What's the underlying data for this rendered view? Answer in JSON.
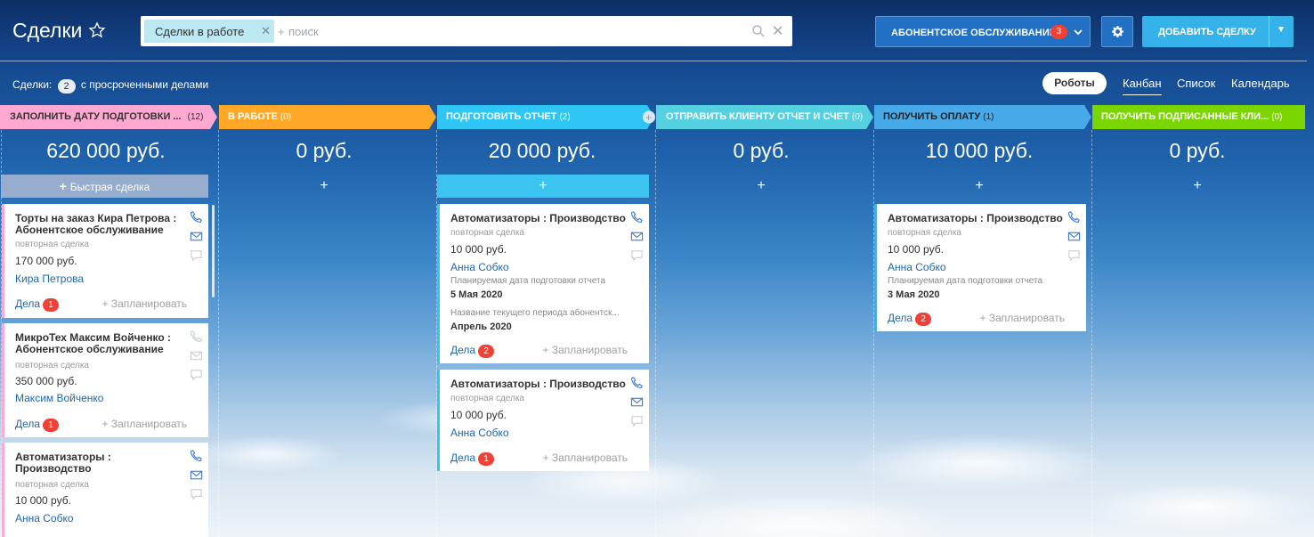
{
  "header": {
    "title": "Сделки",
    "filter_chip": "Сделки в работе",
    "search_plus": "+",
    "search_placeholder": "поиск",
    "category": "АБОНЕНТСКОЕ ОБСЛУЖИВАНИЕ",
    "category_badge": "3",
    "add_deal": "ДОБАВИТЬ СДЕЛКУ"
  },
  "subbar": {
    "deals_label": "Сделки:",
    "deals_count": "2",
    "deals_suffix": "с просроченными делами",
    "robots": "Роботы",
    "tabs": [
      "Канбан",
      "Список",
      "Календарь"
    ]
  },
  "colors": {
    "stage1": "#ffa8d2",
    "stage2": "#ffa726",
    "stage3": "#2fc6f6",
    "stage4": "#55d0e0",
    "stage5": "#47a9e8",
    "stage6": "#7bd500",
    "badge": "#ef4136",
    "link": "#2067b0"
  },
  "stages": [
    {
      "name": "ЗАПОЛНИТЬ ДАТУ ПОДГОТОВКИ ...",
      "count": "(12)",
      "sum": "620 000 руб.",
      "quick": "Быстрая сделка"
    },
    {
      "name": "В РАБОТЕ",
      "count": "(0)",
      "sum": "0 руб.",
      "quick": "+"
    },
    {
      "name": "ПОДГОТОВИТЬ ОТЧЕТ",
      "count": "(2)",
      "sum": "20 000 руб.",
      "quick": "+"
    },
    {
      "name": "ОТПРАВИТЬ КЛИЕНТУ ОТЧЕТ И СЧЕТ",
      "count": "(0)",
      "sum": "0 руб.",
      "quick": "+"
    },
    {
      "name": "ПОЛУЧИТЬ ОПЛАТУ",
      "count": "(1)",
      "sum": "10 000 руб.",
      "quick": "+"
    },
    {
      "name": "ПОЛУЧИТЬ ПОДПИСАННЫЕ КЛИ...",
      "count": "(0)",
      "sum": "0 руб.",
      "quick": "+"
    }
  ],
  "cards": {
    "c1": {
      "title": "Торты на заказ Кира Петрова : Абонентское обслуживание",
      "sub": "повторная сделка",
      "price": "170 000 руб.",
      "person": "Кира Петрова",
      "deals": "Дела",
      "badge": "1",
      "plan": "+ Запланировать"
    },
    "c2": {
      "title": "МикроТех Максим Войченко : Абонентское обслуживание",
      "sub": "повторная сделка",
      "price": "350 000 руб.",
      "person": "Максим Войченко",
      "deals": "Дела",
      "badge": "1",
      "plan": "+ Запланировать"
    },
    "c3": {
      "title": "Автоматизаторы : Производство",
      "sub": "повторная сделка",
      "price": "10 000 руб.",
      "person": "Анна Собко"
    },
    "c4": {
      "title": "Автоматизаторы : Производство",
      "sub": "повторная сделка",
      "price": "10 000 руб.",
      "person": "Анна Собко",
      "label1": "Планируемая дата подготовки отчета",
      "val1": "5 Мая 2020",
      "label2": "Название текущего периода абонентск...",
      "val2": "Апрель 2020",
      "deals": "Дела",
      "badge": "2",
      "plan": "+ Запланировать"
    },
    "c5": {
      "title": "Автоматизаторы : Производство",
      "sub": "повторная сделка",
      "price": "10 000 руб.",
      "person": "Анна Собко",
      "deals": "Дела",
      "badge": "1",
      "plan": "+ Запланировать"
    },
    "c6": {
      "title": "Автоматизаторы : Производство",
      "sub": "повторная сделка",
      "price": "10 000 руб.",
      "person": "Анна Собко",
      "label1": "Планируемая дата подготовки отчета",
      "val1": "3 Мая 2020",
      "deals": "Дела",
      "badge": "2",
      "plan": "+ Запланировать"
    }
  }
}
